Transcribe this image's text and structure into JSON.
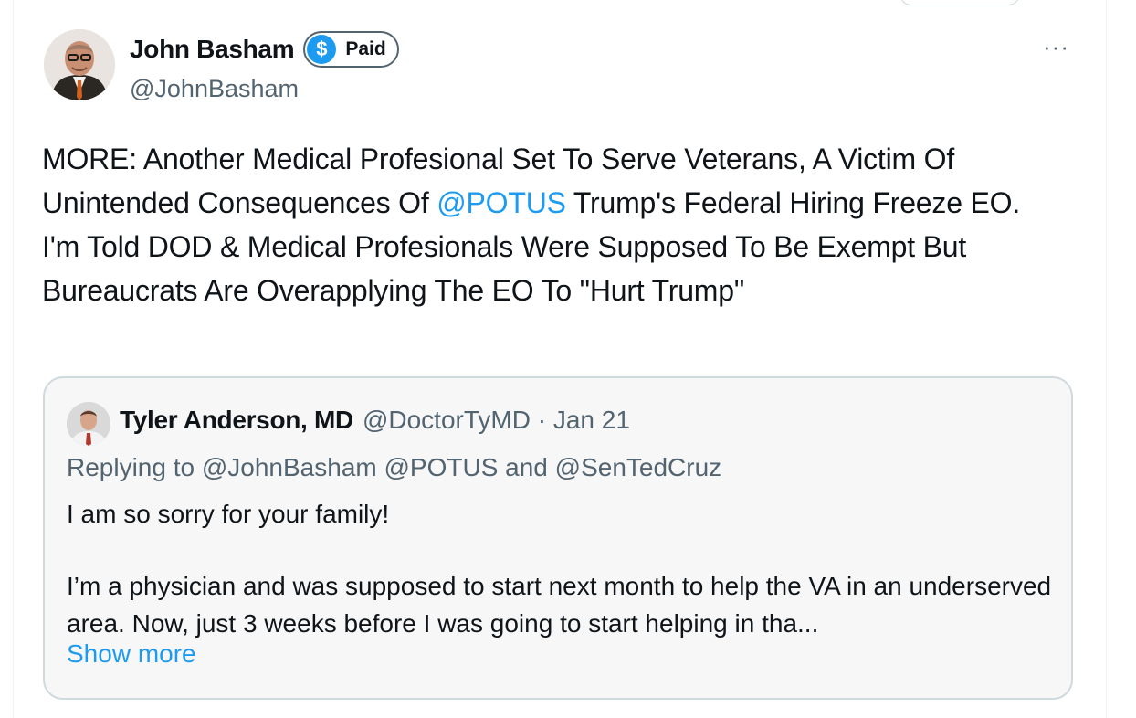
{
  "tweet": {
    "author_name": "John Basham",
    "badge_label": "Paid",
    "badge_icon": "$",
    "handle": "@JohnBasham",
    "more_icon": "···",
    "text_line1": "MORE: Another Medical Profesional Set To Serve Veterans, A Victim Of Unintended Consequences Of ",
    "mention": "@POTUS",
    "text_line1_rest": " Trump's Federal Hiring Freeze EO.",
    "text_line2": "I'm Told DOD & Medical Profesionals Were Supposed To Be Exempt But Bureaucrats Are Overapplying The EO To \"Hurt Trump\""
  },
  "quote": {
    "author_name": "Tyler Anderson, MD",
    "meta": "@DoctorTyMD · Jan 21",
    "reply_line": "Replying to @JohnBasham @POTUS and @SenTedCruz",
    "para1": "I am so sorry for your family!",
    "para2": "I’m a physician and was supposed to start next month to help the VA in an underserved area. Now, just 3 weeks before I was going to start helping in tha...",
    "show_more": "Show more"
  },
  "colors": {
    "accent": "#1d9bf0",
    "secondary_text": "#536471",
    "quote_bg": "#f7f7f7"
  }
}
